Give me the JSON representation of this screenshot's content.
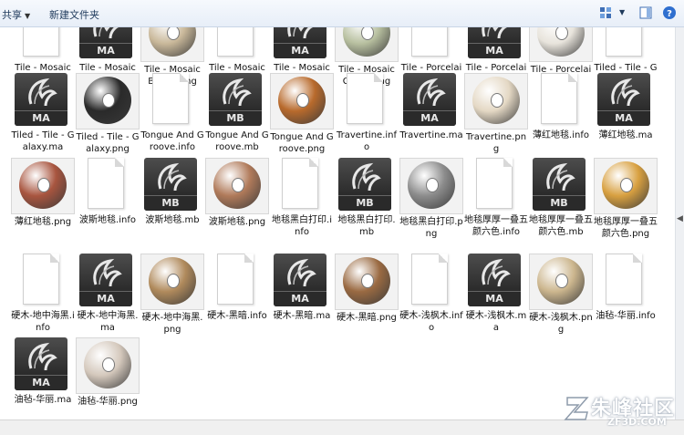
{
  "toolbar": {
    "share_label": "共享",
    "new_folder_label": "新建文件夹",
    "view_icon": "view-options-icon",
    "preview_icon": "preview-pane-icon",
    "help_icon": "help-icon"
  },
  "files": {
    "row0": [
      {
        "label": "Tile - Mosaic Brown.info",
        "type": "doc"
      },
      {
        "label": "Tile - Mosaic Brown.ma",
        "type": "ma"
      },
      {
        "label": "Tile - Mosaic Brown.png",
        "type": "png",
        "color": "#c9b89a"
      },
      {
        "label": "Tile - Mosaic Green.info",
        "type": "doc"
      },
      {
        "label": "Tile - Mosaic Green.ma",
        "type": "ma"
      },
      {
        "label": "Tile - Mosaic Green.png",
        "type": "png",
        "color": "#b8c0a0"
      },
      {
        "label": "Tile - Porcelain.info",
        "type": "doc"
      },
      {
        "label": "Tile - Porcelain.ma",
        "type": "ma"
      },
      {
        "label": "Tile - Porcelain.png",
        "type": "png",
        "color": "#e8e4dc"
      },
      {
        "label": "Tiled - Tile - Galaxy.info",
        "type": "doc"
      }
    ],
    "row1": [
      {
        "label": "Tiled - Tile - Galaxy.ma",
        "type": "ma"
      },
      {
        "label": "Tiled - Tile - Galaxy.png",
        "type": "png",
        "color": "#2a2a2a"
      },
      {
        "label": "Tongue And Groove.info",
        "type": "doc"
      },
      {
        "label": "Tongue And Groove.mb",
        "type": "mb"
      },
      {
        "label": "Tongue And Groove.png",
        "type": "png",
        "color": "#b86a2c"
      },
      {
        "label": "Travertine.info",
        "type": "doc"
      },
      {
        "label": "Travertine.ma",
        "type": "ma"
      },
      {
        "label": "Travertine.png",
        "type": "png",
        "color": "#e4d8c4"
      },
      {
        "label": "薄红地毯.info",
        "type": "doc"
      },
      {
        "label": "薄红地毯.ma",
        "type": "ma"
      }
    ],
    "row2": [
      {
        "label": "薄红地毯.png",
        "type": "png",
        "color": "#a8553f"
      },
      {
        "label": "波斯地毯.info",
        "type": "doc"
      },
      {
        "label": "波斯地毯.mb",
        "type": "mb"
      },
      {
        "label": "波斯地毯.png",
        "type": "png",
        "color": "#b07a5a"
      },
      {
        "label": "地毯黑白打印.info",
        "type": "doc"
      },
      {
        "label": "地毯黑白打印.mb",
        "type": "mb"
      },
      {
        "label": "地毯黑白打印.png",
        "type": "png",
        "color": "#8c8c8c"
      },
      {
        "label": "地毯厚厚一叠五颜六色.info",
        "type": "doc"
      },
      {
        "label": "地毯厚厚一叠五颜六色.mb",
        "type": "mb"
      },
      {
        "label": "地毯厚厚一叠五颜六色.png",
        "type": "png",
        "color": "#d8a040"
      }
    ],
    "row3": [
      {
        "label": "硬木-地中海黑.info",
        "type": "doc"
      },
      {
        "label": "硬木-地中海黑.ma",
        "type": "ma"
      },
      {
        "label": "硬木-地中海黑.png",
        "type": "png",
        "color": "#b08a5c"
      },
      {
        "label": "硬木-黑暗.info",
        "type": "doc"
      },
      {
        "label": "硬木-黑暗.ma",
        "type": "ma"
      },
      {
        "label": "硬木-黑暗.png",
        "type": "png",
        "color": "#9a6a42"
      },
      {
        "label": "硬木-浅枫木.info",
        "type": "doc"
      },
      {
        "label": "硬木-浅枫木.ma",
        "type": "ma"
      },
      {
        "label": "硬木-浅枫木.png",
        "type": "png",
        "color": "#ccb68e"
      },
      {
        "label": "油毡-华丽.info",
        "type": "doc"
      }
    ],
    "row4": [
      {
        "label": "油毡-华丽.ma",
        "type": "ma"
      },
      {
        "label": "油毡-华丽.png",
        "type": "png",
        "color": "#d4c8bc"
      }
    ]
  },
  "watermark": {
    "text": "朱峰社区",
    "sub": "ZF3D.COM"
  }
}
